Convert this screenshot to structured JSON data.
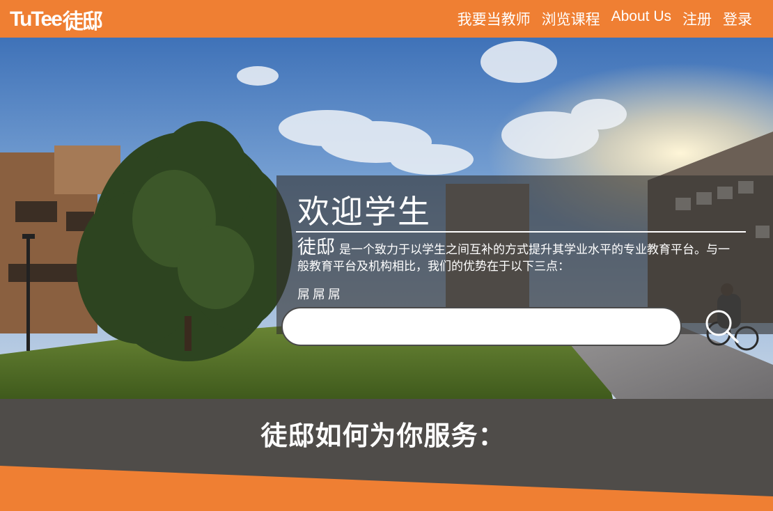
{
  "header": {
    "logo_latin": "TuTee",
    "logo_cjk": "徒邸",
    "nav": [
      "我要当教师",
      "浏览课程",
      "About Us",
      "注册",
      "登录"
    ]
  },
  "hero": {
    "title": "欢迎学生",
    "intro_brand": "徒邸",
    "intro_text": "是一个致力于以学生之间互补的方式提升其学业水平的专业教育平台。与一般教育平台及机构相比，我们的优势在于以下三点：",
    "intro_extra": "屌屌屌",
    "search_placeholder": ""
  },
  "services": {
    "title": "徒邸如何为你服务："
  },
  "colors": {
    "brand_orange": "#ef7f33",
    "panel_dark": "#4f4c49"
  }
}
